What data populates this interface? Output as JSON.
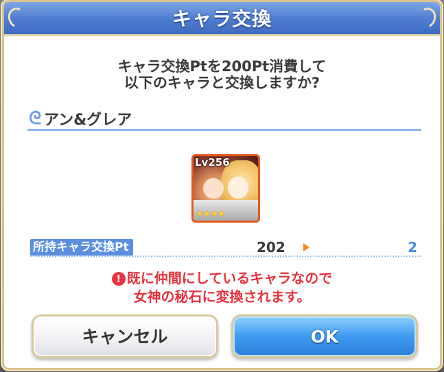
{
  "dialog": {
    "title": "キャラ交換",
    "message_line1": "キャラ交換Ptを200Pt消費して",
    "message_line2": "以下のキャラと交換しますか?"
  },
  "character": {
    "name": "アン&グレア",
    "level": "Lv256",
    "stars": "★★★★",
    "star_count": 4
  },
  "points": {
    "label": "所持キャラ交換Pt",
    "before": "202",
    "after": "2"
  },
  "warning": {
    "icon": "!",
    "line1": "既に仲間にしているキャラなので",
    "line2": "女神の秘石に変換されます。"
  },
  "buttons": {
    "cancel_label": "キャンセル",
    "ok_label": "OK"
  },
  "colors": {
    "title_bar": "#4b7bd0",
    "ok_button": "#3f9bf0",
    "warning_text": "#e8323c",
    "points_label_bg": "#5a8fe0",
    "points_after": "#4a8de0"
  }
}
